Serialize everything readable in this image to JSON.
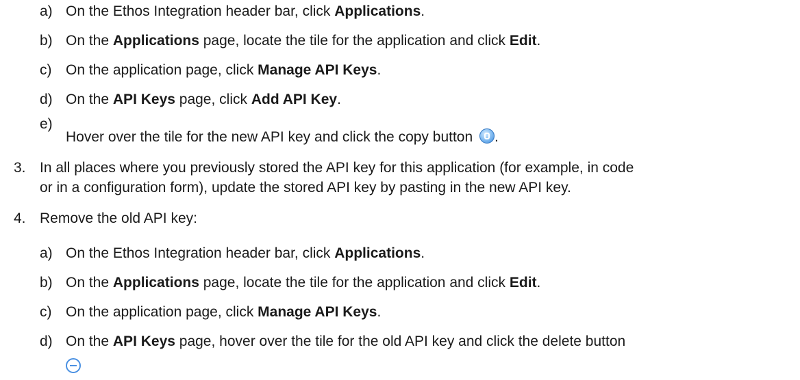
{
  "steps": {
    "step2_sub": [
      {
        "marker": "a)",
        "parts": [
          {
            "t": "On the Ethos Integration header bar, click "
          },
          {
            "b": "Applications"
          },
          {
            "t": "."
          }
        ]
      },
      {
        "marker": "b)",
        "parts": [
          {
            "t": "On the "
          },
          {
            "b": "Applications"
          },
          {
            "t": " page, locate the tile for the application and click "
          },
          {
            "b": "Edit"
          },
          {
            "t": "."
          }
        ]
      },
      {
        "marker": "c)",
        "parts": [
          {
            "t": "On the application page, click "
          },
          {
            "b": "Manage API Keys"
          },
          {
            "t": "."
          }
        ]
      },
      {
        "marker": "d)",
        "parts": [
          {
            "t": "On the "
          },
          {
            "b": "API Keys"
          },
          {
            "t": " page, click "
          },
          {
            "b": "Add API Key"
          },
          {
            "t": "."
          }
        ]
      },
      {
        "marker": "e)",
        "parts": [
          {
            "t": "Hover over the tile for the new API key and click the copy button "
          }
        ],
        "icon": "copy-button-icon",
        "tail": "."
      }
    ],
    "step3": {
      "marker": "3.",
      "line1": "In all places where you previously stored the API key for this application (for example, in code",
      "line2": "or in a configuration form), update the stored API key by pasting in the new API key."
    },
    "step4": {
      "marker": "4.",
      "text": "Remove the old API key:"
    },
    "step4_sub": [
      {
        "marker": "a)",
        "parts": [
          {
            "t": "On the Ethos Integration header bar, click "
          },
          {
            "b": "Applications"
          },
          {
            "t": "."
          }
        ]
      },
      {
        "marker": "b)",
        "parts": [
          {
            "t": "On the "
          },
          {
            "b": "Applications"
          },
          {
            "t": " page, locate the tile for the application and click "
          },
          {
            "b": "Edit"
          },
          {
            "t": "."
          }
        ]
      },
      {
        "marker": "c)",
        "parts": [
          {
            "t": "On the application page, click "
          },
          {
            "b": "Manage API Keys"
          },
          {
            "t": "."
          }
        ]
      },
      {
        "marker": "d)",
        "parts": [
          {
            "t": "On the "
          },
          {
            "b": "API Keys"
          },
          {
            "t": " page, hover over the tile for the old API key and click the delete button"
          }
        ],
        "icon": "delete-button-icon"
      }
    ]
  },
  "colors": {
    "icon_blue": "#4a90e2"
  }
}
